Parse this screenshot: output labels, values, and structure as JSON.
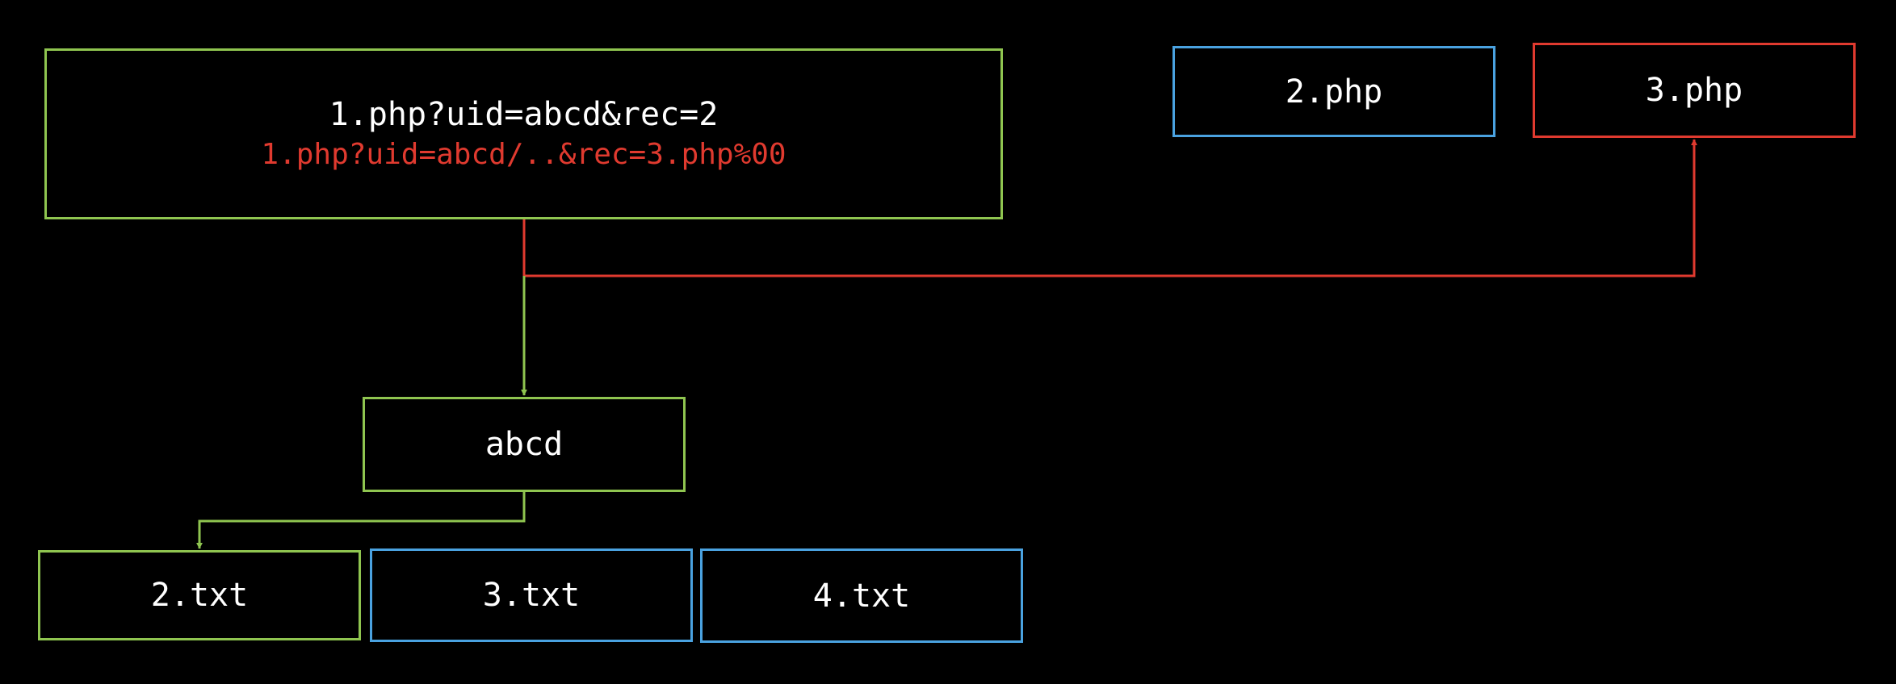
{
  "nodes": {
    "request": {
      "normal": "1.php?uid=abcd&rec=2",
      "attack": "1.php?uid=abcd/..&rec=3.php%00"
    },
    "file_2php": "2.php",
    "file_3php": "3.php",
    "dir_abcd": "abcd",
    "file_2txt": "2.txt",
    "file_3txt": "3.txt",
    "file_4txt": "4.txt"
  },
  "colors": {
    "background": "#000000",
    "normal_path": "#8fc550",
    "other_files": "#4aa2e0",
    "attack_path": "#e03a2f",
    "text": "#ffffff"
  }
}
